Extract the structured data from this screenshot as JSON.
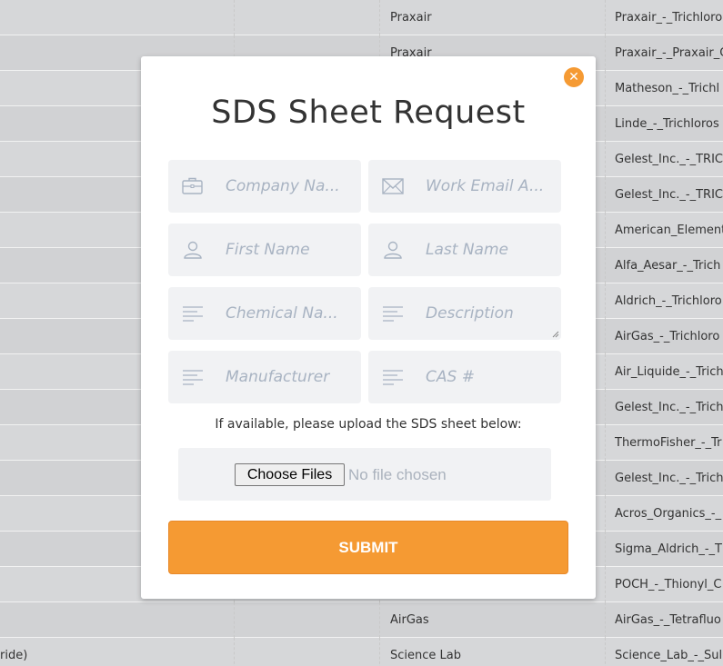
{
  "background_table": {
    "rows": [
      {
        "col1": "",
        "col2": "",
        "col3": "Praxair",
        "col4": "Praxair_-_Trichloro"
      },
      {
        "col1": "",
        "col2": "",
        "col3": "Praxair",
        "col4": "Praxair_-_Praxair_C"
      },
      {
        "col1": "",
        "col2": "",
        "col3": "",
        "col4": "Matheson_-_Trichl"
      },
      {
        "col1": "",
        "col2": "",
        "col3": "",
        "col4": "Linde_-_Trichloros"
      },
      {
        "col1": "",
        "col2": "",
        "col3": "",
        "col4": "Gelest_Inc._-_TRIC"
      },
      {
        "col1": "",
        "col2": "",
        "col3": "",
        "col4": "Gelest_Inc._-_TRIC"
      },
      {
        "col1": "",
        "col2": "",
        "col3": "",
        "col4": "American_Element"
      },
      {
        "col1": "",
        "col2": "",
        "col3": "",
        "col4": "Alfa_Aesar_-_Trich"
      },
      {
        "col1": "",
        "col2": "",
        "col3": "",
        "col4": "Aldrich_-_Trichloro"
      },
      {
        "col1": "",
        "col2": "",
        "col3": "",
        "col4": "AirGas_-_Trichloro"
      },
      {
        "col1": "",
        "col2": "",
        "col3": "",
        "col4": "Air_Liquide_-_Trich"
      },
      {
        "col1": "",
        "col2": "",
        "col3": "",
        "col4": "Gelest_Inc._-_Trich"
      },
      {
        "col1": "",
        "col2": "",
        "col3": "",
        "col4": "ThermoFisher_-_Tr"
      },
      {
        "col1": "",
        "col2": "",
        "col3": "",
        "col4": "Gelest_Inc._-_Trich"
      },
      {
        "col1": "",
        "col2": "",
        "col3": "",
        "col4": "Acros_Organics_-_"
      },
      {
        "col1": "",
        "col2": "",
        "col3": "",
        "col4": "Sigma_Aldrich_-_T"
      },
      {
        "col1": "",
        "col2": "",
        "col3": "",
        "col4": "POCH_-_Thionyl_C"
      },
      {
        "col1": "",
        "col2": "",
        "col3": "AirGas",
        "col4": "AirGas_-_Tetrafluo"
      },
      {
        "col1": "ride)",
        "col2": "",
        "col3": "Science Lab",
        "col4": "Science_Lab_-_Sul"
      }
    ]
  },
  "modal": {
    "title": "SDS Sheet Request",
    "close_icon": "close-icon",
    "fields": {
      "company": {
        "placeholder": "Company Na...",
        "icon": "briefcase-icon"
      },
      "email": {
        "placeholder": "Work Email A...",
        "icon": "envelope-icon"
      },
      "first_name": {
        "placeholder": "First Name",
        "icon": "user-icon"
      },
      "last_name": {
        "placeholder": "Last Name",
        "icon": "user-icon"
      },
      "chemical": {
        "placeholder": "Chemical Na...",
        "icon": "text-lines-icon"
      },
      "description": {
        "placeholder": "Description",
        "icon": "text-lines-icon"
      },
      "manufacturer": {
        "placeholder": "Manufacturer",
        "icon": "text-lines-icon"
      },
      "cas": {
        "placeholder": "CAS #",
        "icon": "text-lines-icon"
      }
    },
    "upload_note": "If available, please upload the SDS sheet below:",
    "choose_files_label": "Choose Files",
    "no_file_label": "No file chosen",
    "submit_label": "SUBMIT"
  },
  "colors": {
    "accent": "#f59a33",
    "field_bg": "#f1f2f4",
    "placeholder": "#a8b3c2",
    "page_bg": "#d6d7d9"
  }
}
